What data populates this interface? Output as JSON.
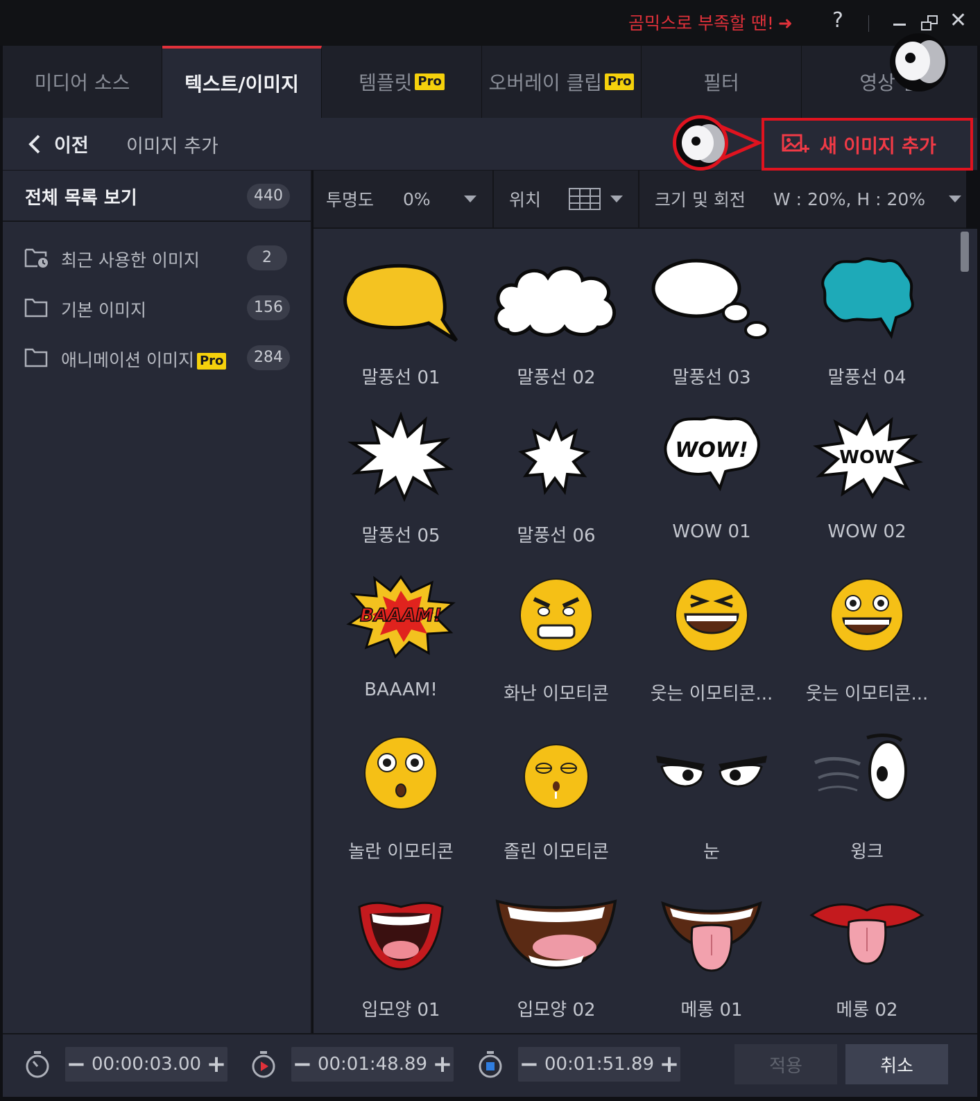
{
  "titlebar": {
    "promo_text": "곰믹스로 부족할 땐!",
    "promo_arrow": "➜",
    "help": "?",
    "close": "✕"
  },
  "tabs": [
    {
      "label": "미디어 소스",
      "pro": ""
    },
    {
      "label": "텍스트/이미지",
      "pro": ""
    },
    {
      "label": "템플릿",
      "pro": "Pro"
    },
    {
      "label": "오버레이 클립",
      "pro": "Pro"
    },
    {
      "label": "필터",
      "pro": ""
    },
    {
      "label": "영상 전",
      "pro": ""
    }
  ],
  "subheader": {
    "back_label": "이전",
    "title": "이미지 추가",
    "new_image_button": "새 이미지 추가"
  },
  "sidebar": {
    "all_label": "전체 목록 보기",
    "all_count": "440",
    "categories": [
      {
        "label": "최근 사용한 이미지",
        "count": "2",
        "pro": "",
        "icon": "recent-folder-icon"
      },
      {
        "label": "기본 이미지",
        "count": "156",
        "pro": "",
        "icon": "folder-icon"
      },
      {
        "label": "애니메이션 이미지",
        "count": "284",
        "pro": "Pro",
        "icon": "folder-icon"
      }
    ]
  },
  "toolbar": {
    "opacity_label": "투명도",
    "opacity_value": "0%",
    "position_label": "위치",
    "size_label": "크기 및 회전",
    "size_value": "W : 20%, H : 20%"
  },
  "images": [
    {
      "label": "말풍선 01",
      "icon": "yellow-speech-bubble"
    },
    {
      "label": "말풍선 02",
      "icon": "cloud-speech-bubble"
    },
    {
      "label": "말풍선 03",
      "icon": "thought-bubble"
    },
    {
      "label": "말풍선 04",
      "icon": "teal-speech-bubble"
    },
    {
      "label": "말풍선 05",
      "icon": "burst-bubble"
    },
    {
      "label": "말풍선 06",
      "icon": "star-burst-bubble"
    },
    {
      "label": "WOW 01",
      "icon": "wow-cloud-bubble",
      "art_text": "WOW!"
    },
    {
      "label": "WOW 02",
      "icon": "wow-burst-bubble",
      "art_text": "WOW"
    },
    {
      "label": "BAAAM!",
      "icon": "baaam-explosion",
      "art_text": "BAAAM!"
    },
    {
      "label": "화난 이모티콘",
      "icon": "angry-emoji"
    },
    {
      "label": "웃는 이모티콘...",
      "icon": "laughing-emoji"
    },
    {
      "label": "웃는 이모티콘...",
      "icon": "smiling-emoji"
    },
    {
      "label": "놀란 이모티콘",
      "icon": "surprised-emoji"
    },
    {
      "label": "졸린 이모티콘",
      "icon": "sleepy-emoji"
    },
    {
      "label": "눈",
      "icon": "angry-eyes"
    },
    {
      "label": "윙크",
      "icon": "wink-eye"
    },
    {
      "label": "입모양 01",
      "icon": "open-mouth-lips"
    },
    {
      "label": "입모양 02",
      "icon": "wide-smile-mouth"
    },
    {
      "label": "메롱 01",
      "icon": "tongue-out-mouth"
    },
    {
      "label": "메롱 02",
      "icon": "tongue-out-lips"
    }
  ],
  "footer": {
    "timecode_1": "00:00:03.00",
    "timecode_2": "00:01:48.89",
    "timecode_3": "00:01:51.89",
    "minus": "−",
    "plus": "+",
    "apply_label": "적용",
    "cancel_label": "취소"
  },
  "colors": {
    "accent_red": "#e0313a",
    "pro_badge": "#f5d10c",
    "panel": "#262936"
  }
}
